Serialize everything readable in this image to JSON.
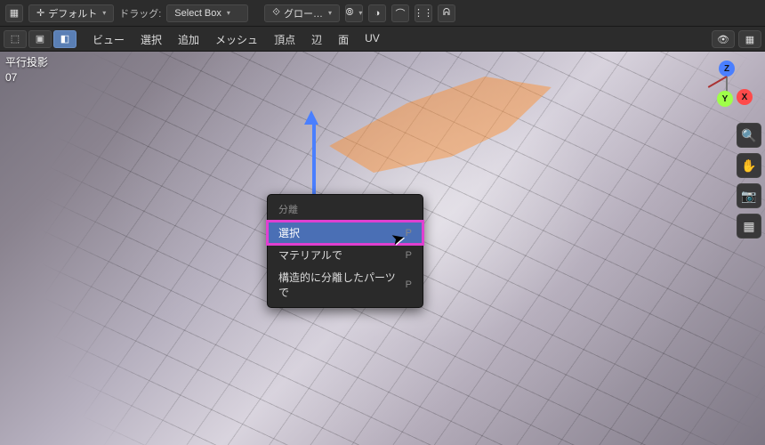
{
  "header": {
    "orientation_label": "デフォルト",
    "drag_label": "ドラッグ:",
    "drag_mode": "Select Box",
    "transform_label": "グロー…"
  },
  "toolbar2": {
    "menus": [
      "ビュー",
      "選択",
      "追加",
      "メッシュ",
      "頂点",
      "辺",
      "面",
      "UV"
    ]
  },
  "overlay": {
    "projection": "平行投影",
    "meters": "07"
  },
  "gizmo": {
    "z": "Z",
    "y": "Y",
    "x": "X"
  },
  "context_menu": {
    "title": "分離",
    "items": [
      {
        "label": "選択",
        "shortcut": "P"
      },
      {
        "label": "マテリアルで",
        "shortcut": "P"
      },
      {
        "label": "構造的に分離したパーツで",
        "shortcut": "P"
      }
    ],
    "highlighted_index": 0
  }
}
